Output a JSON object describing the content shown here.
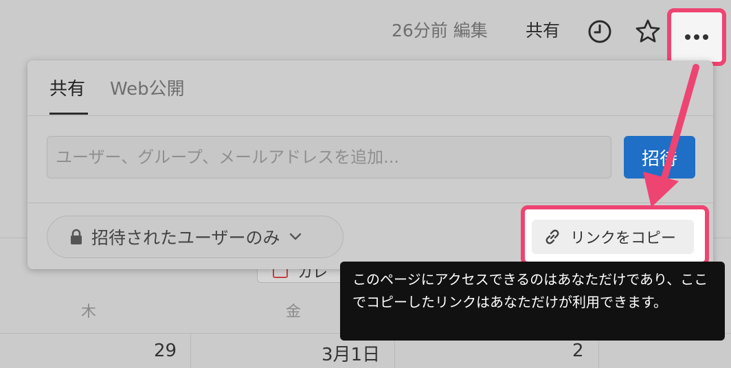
{
  "topbar": {
    "edited_label": "26分前 編集",
    "share_label": "共有",
    "history_icon": "clock-icon",
    "favorite_icon": "star-icon",
    "more_icon": "more-horizontal-icon"
  },
  "share_popup": {
    "tabs": [
      "共有",
      "Web公開"
    ],
    "active_tab": 0,
    "invite_placeholder": "ユーザー、グループ、メールアドレスを追加...",
    "invite_button": "招待",
    "access_level": "招待されたユーザーのみ",
    "copy_link_label": "リンクをコピー"
  },
  "tooltip": {
    "text": "このページにアクセスできるのはあなただけであり、ここでコピーしたリンクはあなただけが利用できます。"
  },
  "calendar_bg": {
    "chip_label": "カレ",
    "weekdays": [
      "木",
      "金"
    ],
    "days": [
      "29",
      "3月1日",
      "2"
    ]
  },
  "colors": {
    "highlight": "#ee4472",
    "primary": "#1f6fc6",
    "tooltip_bg": "#111111"
  }
}
